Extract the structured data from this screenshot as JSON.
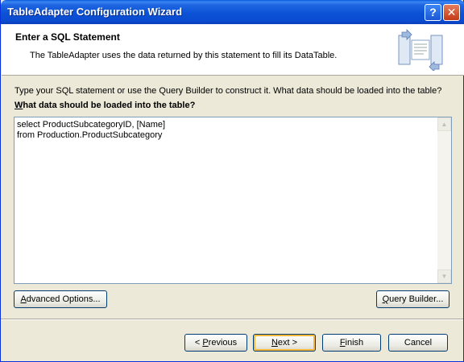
{
  "window": {
    "title": "TableAdapter Configuration Wizard",
    "help_glyph": "?",
    "close_glyph": "✕"
  },
  "header": {
    "title": "Enter a SQL Statement",
    "description": "The TableAdapter uses the data returned by this statement to fill its DataTable.",
    "icon": "wizard-database-icon"
  },
  "instruction": "Type your SQL statement or use the Query Builder to construct it. What data should be loaded into the table?",
  "question": {
    "accel": "W",
    "rest": "hat data should be loaded into the table?"
  },
  "sql": {
    "text": "select ProductSubcategoryID, [Name]\nfrom Production.ProductSubcategory"
  },
  "buttons": {
    "advanced": {
      "accel": "A",
      "rest": "dvanced Options..."
    },
    "query_builder": {
      "pre": "",
      "accel": "Q",
      "rest": "uery Builder..."
    },
    "previous": {
      "pre": "< ",
      "accel": "P",
      "rest": "revious"
    },
    "next": {
      "pre": "",
      "accel": "N",
      "rest": "ext >"
    },
    "finish": {
      "pre": "",
      "accel": "F",
      "rest": "inish"
    },
    "cancel": "Cancel"
  },
  "colors": {
    "titlebar": "#0a4ccf",
    "dialog_bg": "#ece9d8",
    "default_button_highlight": "#f8b836"
  }
}
